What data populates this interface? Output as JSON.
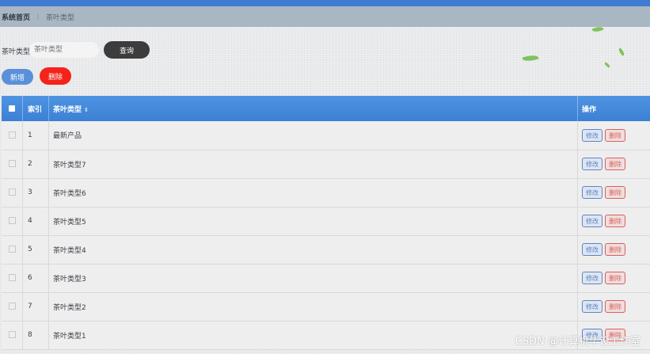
{
  "breadcrumb": {
    "home": "系统首页",
    "separator": "⋮",
    "current": "茶叶类型"
  },
  "search": {
    "label": "茶叶类型",
    "placeholder": "茶叶类型",
    "query_button": "查询"
  },
  "actions": {
    "add_button": "新增",
    "delete_button": "删除"
  },
  "table": {
    "columns": {
      "index": "索引",
      "type": "茶叶类型",
      "sort_icon": "⇕",
      "operation": "操作"
    },
    "rows": [
      {
        "index": "1",
        "type": "最新产品"
      },
      {
        "index": "2",
        "type": "茶叶类型7"
      },
      {
        "index": "3",
        "type": "茶叶类型6"
      },
      {
        "index": "4",
        "type": "茶叶类型5"
      },
      {
        "index": "5",
        "type": "茶叶类型4"
      },
      {
        "index": "6",
        "type": "茶叶类型3"
      },
      {
        "index": "7",
        "type": "茶叶类型2"
      },
      {
        "index": "8",
        "type": "茶叶类型1"
      }
    ],
    "row_actions": {
      "edit": "修改",
      "delete": "删除"
    }
  },
  "watermark": "CSDN @计算机毕设工作室",
  "colors": {
    "header_blue": "#3f7bd0",
    "delete_red": "#f5231a",
    "query_dark": "#3c3c3c",
    "add_blue": "#5a90d9"
  }
}
